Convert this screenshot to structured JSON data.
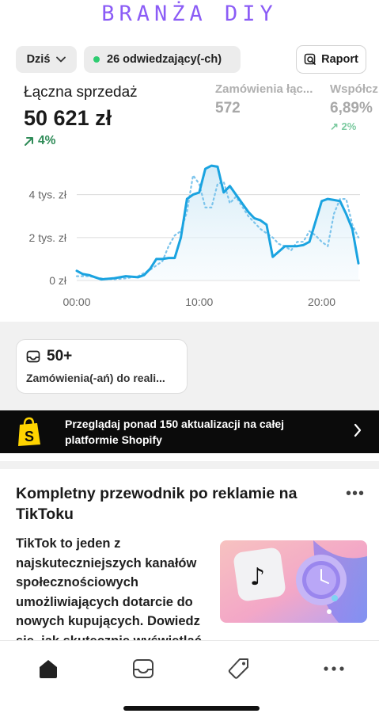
{
  "brand": {
    "title": "BRANŻA DIY",
    "color": "#8b5cf6"
  },
  "topbar": {
    "date_label": "Dziś",
    "visitors_label": "26 odwiedzający(-ch)",
    "report_label": "Raport"
  },
  "metrics": {
    "main": {
      "label": "Łączna sprzedaż",
      "value": "50 621 zł",
      "delta": "4%"
    },
    "orders": {
      "label": "Zamówienia łąc...",
      "value": "572"
    },
    "conversion": {
      "label": "Współcz",
      "value": "6,89%",
      "delta": "2%"
    }
  },
  "chart_data": {
    "type": "line",
    "x_tick_labels": [
      "00:00",
      "10:00",
      "20:00"
    ],
    "y_tick_labels": [
      "0 zł",
      "2 tys. zł",
      "4 tys. zł"
    ],
    "ylim": [
      0,
      5500
    ],
    "x_range_hours": [
      0,
      23
    ],
    "grid": true,
    "series": [
      {
        "style": "solid",
        "color": "#1aa3e0",
        "x": [
          0,
          0.5,
          1,
          1.5,
          2,
          3,
          4,
          5,
          5.5,
          6,
          6.5,
          7,
          7.5,
          8,
          8.5,
          9,
          9.5,
          10,
          10.5,
          11,
          11.5,
          12,
          12.5,
          13,
          14,
          14.5,
          15,
          15.5,
          16,
          17,
          18,
          18.5,
          19,
          20,
          20.5,
          21,
          21.5,
          22,
          22.5,
          23
        ],
        "values": [
          450,
          300,
          250,
          150,
          50,
          100,
          200,
          150,
          250,
          550,
          1000,
          1000,
          1050,
          1050,
          2000,
          3800,
          4000,
          4100,
          5200,
          5350,
          5300,
          4100,
          4400,
          4000,
          3200,
          2900,
          2800,
          2600,
          1100,
          1600,
          1600,
          1650,
          1800,
          3700,
          3800,
          3750,
          3700,
          3100,
          2400,
          800
        ]
      },
      {
        "style": "dotted",
        "color": "#7cc4ec",
        "x": [
          0,
          1,
          2,
          3,
          4,
          5,
          6,
          7,
          7.5,
          8,
          8.5,
          9,
          9.5,
          10,
          10.5,
          11,
          11.5,
          12,
          12.5,
          13,
          14,
          15,
          16,
          16.5,
          17,
          17.5,
          18,
          18.5,
          19,
          19.5,
          20,
          20.5,
          21,
          21.5,
          22,
          22.5,
          23
        ],
        "values": [
          200,
          200,
          100,
          50,
          100,
          200,
          500,
          900,
          1600,
          2100,
          2300,
          3200,
          4900,
          4500,
          3400,
          3400,
          4500,
          4600,
          3600,
          3900,
          3000,
          2400,
          2000,
          1700,
          1600,
          1400,
          1800,
          1800,
          2300,
          2100,
          1800,
          1600,
          3100,
          3800,
          3800,
          2600,
          2000
        ]
      }
    ]
  },
  "orders_card": {
    "count": "50+",
    "description": "Zamówienia(-ań) do reali..."
  },
  "promo": {
    "text": "Przeglądaj ponad 150 aktualizacji na całej platformie Shopify"
  },
  "article": {
    "title": "Kompletny przewodnik po reklamie na TikToku",
    "body": "TikTok to jeden z najskuteczniejszych kanałów społecznościowych umożliwiających dotarcie do nowych kupujących. Dowiedz się, jak skutecznie wyświetlać"
  },
  "tabs": [
    {
      "icon": "home-icon",
      "active": true
    },
    {
      "icon": "inbox-icon",
      "active": false
    },
    {
      "icon": "tag-icon",
      "active": false
    },
    {
      "icon": "more-icon",
      "active": false
    }
  ]
}
